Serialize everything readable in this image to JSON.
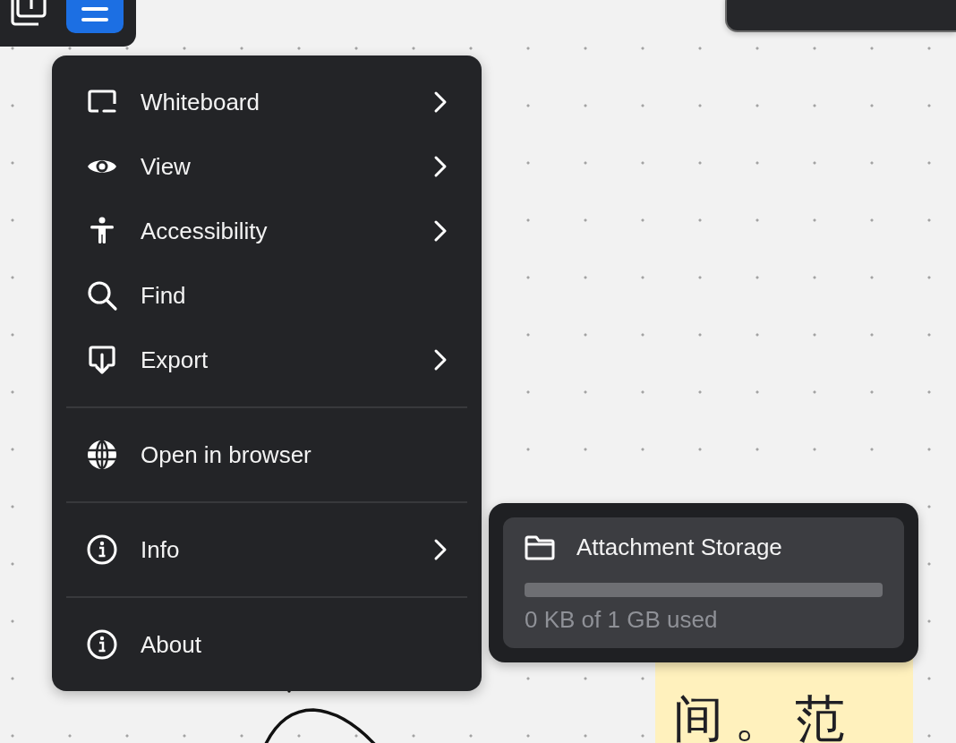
{
  "menu": {
    "items": [
      {
        "kind": "item",
        "label": "Whiteboard",
        "submenu": true
      },
      {
        "kind": "item",
        "label": "View",
        "submenu": true
      },
      {
        "kind": "item",
        "label": "Accessibility",
        "submenu": true
      },
      {
        "kind": "item",
        "label": "Find",
        "submenu": false
      },
      {
        "kind": "item",
        "label": "Export",
        "submenu": true
      },
      {
        "kind": "separator"
      },
      {
        "kind": "item",
        "label": "Open in browser",
        "submenu": false
      },
      {
        "kind": "separator"
      },
      {
        "kind": "item",
        "label": "Info",
        "submenu": true
      },
      {
        "kind": "separator"
      },
      {
        "kind": "item",
        "label": "About",
        "submenu": false
      }
    ]
  },
  "storage": {
    "title": "Attachment Storage",
    "level": 0,
    "usage": "0 KB of 1 GB used"
  },
  "sticky_note": {
    "text": "间。范"
  }
}
